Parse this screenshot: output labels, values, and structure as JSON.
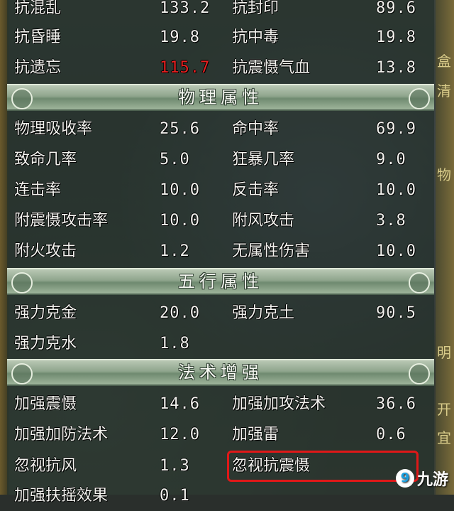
{
  "rows_top": [
    {
      "name1": "抗混乱",
      "val1": "133.2",
      "name2": "抗封印",
      "val2": "89.6"
    },
    {
      "name1": "抗昏睡",
      "val1": "19.8",
      "name2": "抗中毒",
      "val2": "19.8"
    },
    {
      "name1": "抗遗忘",
      "val1": "115.7",
      "name2": "抗震慑气血",
      "val2": "13.8"
    }
  ],
  "sections": [
    {
      "title": "物理属性",
      "rows": [
        {
          "name1": "物理吸收率",
          "val1": "25.6",
          "name2": "命中率",
          "val2": "69.9"
        },
        {
          "name1": "致命几率",
          "val1": "5.0",
          "name2": "狂暴几率",
          "val2": "9.0"
        },
        {
          "name1": "连击率",
          "val1": "10.0",
          "name2": "反击率",
          "val2": "10.0"
        },
        {
          "name1": "附震慑攻击率",
          "val1": "10.0",
          "name2": "附风攻击",
          "val2": "3.8"
        },
        {
          "name1": "附火攻击",
          "val1": "1.2",
          "name2": "无属性伤害",
          "val2": "10.0"
        }
      ]
    },
    {
      "title": "五行属性",
      "rows": [
        {
          "name1": "强力克金",
          "val1": "20.0",
          "name2": "强力克土",
          "val2": "90.5"
        },
        {
          "name1": "强力克水",
          "val1": "1.8",
          "name2": "",
          "val2": ""
        }
      ]
    },
    {
      "title": "法术增强",
      "rows": [
        {
          "name1": "加强震慑",
          "val1": "14.6",
          "name2": "加强加攻法术",
          "val2": "36.6"
        },
        {
          "name1": "加强加防法术",
          "val1": "12.0",
          "name2": "加强雷",
          "val2": "0.6"
        },
        {
          "name1": "忽视抗风",
          "val1": "1.3",
          "name2": "忽视抗震慑",
          "val2": ""
        },
        {
          "name1": "加强扶摇效果",
          "val1": "0.1",
          "name2": "",
          "val2": ""
        }
      ]
    }
  ],
  "colors": {
    "highlight_red": "#e01818",
    "value_red": "#e82020"
  },
  "watermark": {
    "text": "九游",
    "icon": "jiuyou-logo-icon"
  },
  "right_edge_glyphs": [
    "盒",
    "清",
    "物",
    "明",
    "开",
    "宜"
  ]
}
